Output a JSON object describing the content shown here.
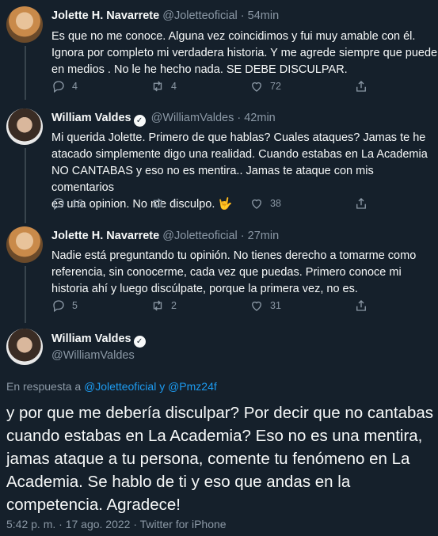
{
  "tweets": [
    {
      "name": "Jolette H. Navarrete",
      "handle": "@Joletteoficial",
      "time": "· 54min",
      "text": "Es que no me conoce. Alguna vez coincidimos y fui muy amable con él.\nIgnora por completo mi verdadera historia. Y me agrede siempre que puede\nen medios . No le he hecho nada. SE DEBE DISCULPAR.",
      "replies": "4",
      "retweets": "4",
      "likes": "72"
    },
    {
      "name": "William Valdes",
      "handle": "@WilliamValdes",
      "time": "· 42min",
      "text": "Mi querida Jolette. Primero de que hablas? Cuales ataques? Jamas te he\natacado simplemente digo una realidad. Cuando estabas en La Academia\nNO CANTABAS y eso no es mentira.. Jamas te ataque con mis comentarios\nes una opinion. No me disculpo. 🤟",
      "replies": "18",
      "retweets": "1",
      "likes": "38"
    },
    {
      "name": "Jolette H. Navarrete",
      "handle": "@Joletteoficial",
      "time": "· 27min",
      "text": "Nadie está preguntando tu opinión. No tienes derecho a tomarme como\nreferencia, sin conocerme, cada vez que puedas.  Primero conoce mi\nhistoria ahí y luego discúlpate, porque la primera vez, no es.",
      "replies": "5",
      "retweets": "2",
      "likes": "31"
    }
  ],
  "main_tweet": {
    "name": "William Valdes",
    "handle": "@WilliamValdes",
    "reply_prefix": "En respuesta a ",
    "reply_mentions": "@Joletteoficial y @Pmz24f",
    "text": "y por que me debería disculpar? Por decir que no cantabas cuando estabas en La Academia? Eso no es una mentira, jamas ataque a tu persona, comente tu fenómeno en La Academia. Se hablo de ti y eso que andas en la competencia. Agradece!",
    "footer": "5:42 p. m. · 17 ago. 2022 · Twitter for iPhone"
  },
  "colors": {
    "background": "#15202b",
    "text": "#f7f9f9",
    "secondary": "#8b98a5",
    "link": "#1d9bf0",
    "divider": "#38444d"
  }
}
